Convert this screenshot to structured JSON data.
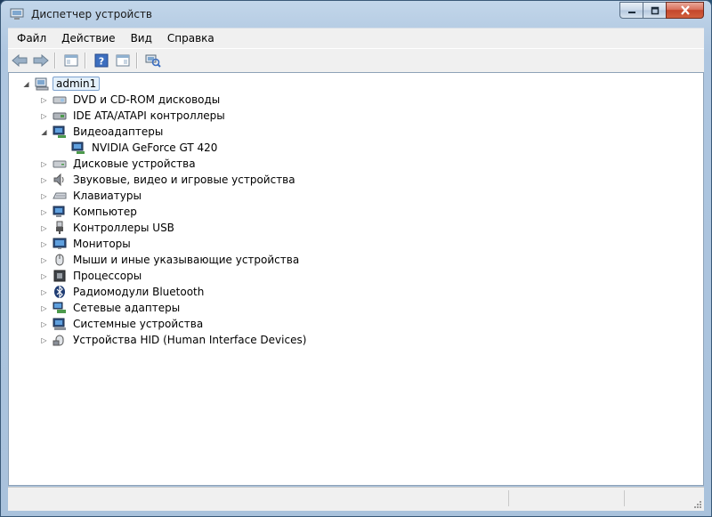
{
  "window": {
    "title": "Диспетчер устройств",
    "icon": "device-manager-icon"
  },
  "menu": [
    "Файл",
    "Действие",
    "Вид",
    "Справка"
  ],
  "toolbar": {
    "buttons": [
      "back-icon",
      "forward-icon",
      "properties-pane-icon",
      "help-icon",
      "show-hide-console-tree-icon",
      "scan-hardware-icon"
    ]
  },
  "tree": {
    "root": {
      "label": "admin1",
      "icon": "computer-icon",
      "expanded": true
    },
    "items": [
      {
        "label": "DVD и CD-ROM дисководы",
        "icon": "dvd-drive-icon",
        "expanded": false
      },
      {
        "label": "IDE ATA/ATAPI контроллеры",
        "icon": "ide-controller-icon",
        "expanded": false
      },
      {
        "label": "Видеоадаптеры",
        "icon": "display-adapter-icon",
        "expanded": true,
        "children": [
          {
            "label": "NVIDIA GeForce GT 420",
            "icon": "display-adapter-icon"
          }
        ]
      },
      {
        "label": "Дисковые устройства",
        "icon": "disk-drive-icon",
        "expanded": false
      },
      {
        "label": "Звуковые, видео и игровые устройства",
        "icon": "speaker-icon",
        "expanded": false
      },
      {
        "label": "Клавиатуры",
        "icon": "keyboard-icon",
        "expanded": false
      },
      {
        "label": "Компьютер",
        "icon": "computer-icon",
        "expanded": false
      },
      {
        "label": "Контроллеры USB",
        "icon": "usb-icon",
        "expanded": false
      },
      {
        "label": "Мониторы",
        "icon": "monitor-icon",
        "expanded": false
      },
      {
        "label": "Мыши и иные указывающие устройства",
        "icon": "mouse-icon",
        "expanded": false
      },
      {
        "label": "Процессоры",
        "icon": "processor-icon",
        "expanded": false
      },
      {
        "label": "Радиомодули Bluetooth",
        "icon": "bluetooth-icon",
        "expanded": false
      },
      {
        "label": "Сетевые адаптеры",
        "icon": "network-adapter-icon",
        "expanded": false
      },
      {
        "label": "Системные устройства",
        "icon": "system-device-icon",
        "expanded": false
      },
      {
        "label": "Устройства HID (Human Interface Devices)",
        "icon": "hid-device-icon",
        "expanded": false
      }
    ]
  },
  "colors": {
    "selection_bg": "#e5f1fb",
    "selection_border": "#7da2ce",
    "close_button": "#c4462c"
  }
}
